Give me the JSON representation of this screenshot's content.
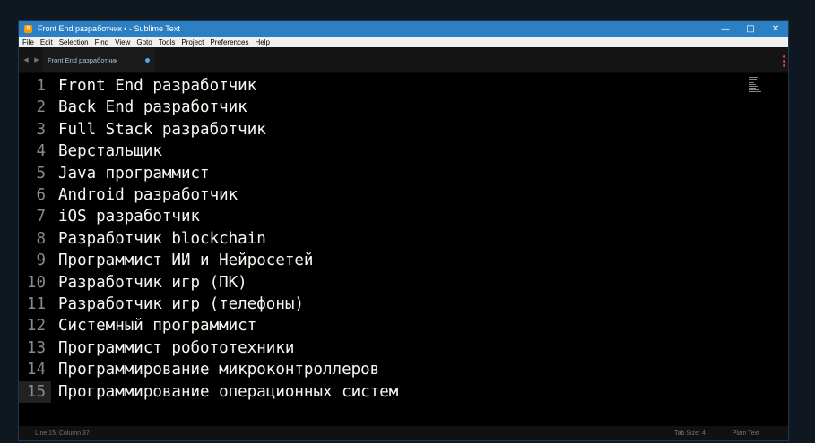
{
  "window": {
    "title": "Front End разработчик • - Sublime Text"
  },
  "menu": [
    "File",
    "Edit",
    "Selection",
    "Find",
    "View",
    "Goto",
    "Tools",
    "Project",
    "Preferences",
    "Help"
  ],
  "tab": {
    "label": "Front End разработчик"
  },
  "editor": {
    "lines": [
      {
        "num": "1",
        "text": "Front End разработчик"
      },
      {
        "num": "2",
        "text": "Back End разработчик"
      },
      {
        "num": "3",
        "text": "Full Stack разработчик"
      },
      {
        "num": "4",
        "text": "Верстальщик"
      },
      {
        "num": "5",
        "text": "Java программист"
      },
      {
        "num": "6",
        "text": "Android разработчик"
      },
      {
        "num": "7",
        "text": "iOS разработчик"
      },
      {
        "num": "8",
        "text": "Разработчик blockchain"
      },
      {
        "num": "9",
        "text": "Программист ИИ и Нейросетей"
      },
      {
        "num": "10",
        "text": "Разработчик игр (ПК)"
      },
      {
        "num": "11",
        "text": "Разработчик игр (телефоны)"
      },
      {
        "num": "12",
        "text": "Системный программист"
      },
      {
        "num": "13",
        "text": "Программист робототехники"
      },
      {
        "num": "14",
        "text": "Программирование микроконтроллеров"
      },
      {
        "num": "15",
        "text": "Программирование операционных систем"
      }
    ],
    "active_line": 15
  },
  "status": {
    "position": "Line 15, Column 37",
    "tab_size": "Tab Size: 4",
    "syntax": "Plain Text"
  },
  "colors": {
    "titlebar": "#2d7fc4",
    "editor_bg": "#000000",
    "text": "#f8f8f2",
    "line_numbers": "#8a8a8a"
  }
}
